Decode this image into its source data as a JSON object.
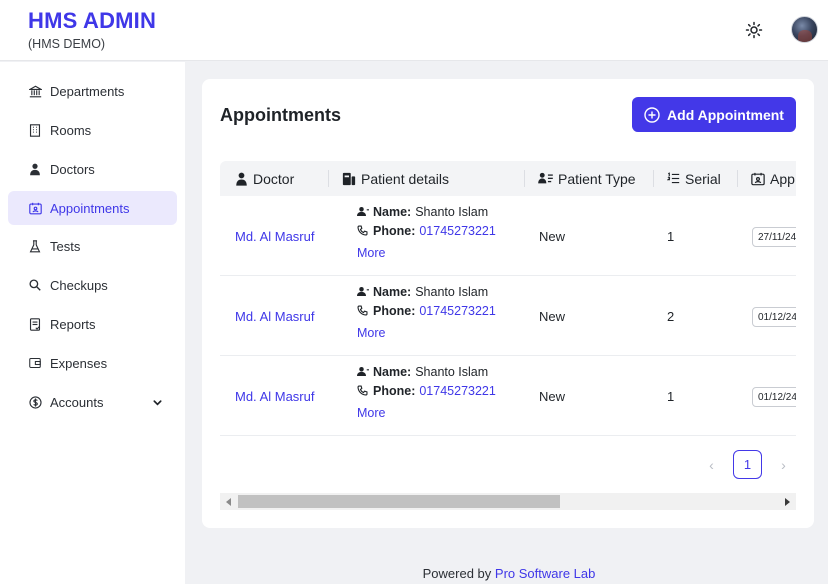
{
  "header": {
    "title": "HMS ADMIN",
    "subtitle": "(HMS DEMO)",
    "theme_icon": "sun-icon",
    "avatar_icon": "user-avatar"
  },
  "sidebar": {
    "items": [
      {
        "label": "Departments",
        "icon": "bank-icon"
      },
      {
        "label": "Rooms",
        "icon": "building-icon"
      },
      {
        "label": "Doctors",
        "icon": "doctor-icon"
      },
      {
        "label": "Appointments",
        "icon": "calendar-person-icon",
        "active": true
      },
      {
        "label": "Tests",
        "icon": "flask-icon"
      },
      {
        "label": "Checkups",
        "icon": "search-icon"
      },
      {
        "label": "Reports",
        "icon": "report-icon"
      },
      {
        "label": "Expenses",
        "icon": "wallet-icon"
      },
      {
        "label": "Accounts",
        "icon": "dollar-circle-icon",
        "expandable": true
      }
    ]
  },
  "main": {
    "title": "Appointments",
    "add_button_label": "Add Appointment",
    "columns": [
      "Doctor",
      "Patient details",
      "Patient Type",
      "Serial",
      "App"
    ],
    "labels": {
      "name": "Name:",
      "phone": "Phone:",
      "more": "More"
    },
    "rows": [
      {
        "doctor": "Md. Al Masruf",
        "patient_name": "Shanto Islam",
        "phone": "01745273221",
        "type": "New",
        "serial": "1",
        "date": "27/11/24"
      },
      {
        "doctor": "Md. Al Masruf",
        "patient_name": "Shanto Islam",
        "phone": "01745273221",
        "type": "New",
        "serial": "2",
        "date": "01/12/24"
      },
      {
        "doctor": "Md. Al Masruf",
        "patient_name": "Shanto Islam",
        "phone": "01745273221",
        "type": "New",
        "serial": "1",
        "date": "01/12/24"
      }
    ],
    "pagination": {
      "current": "1",
      "prev": "‹",
      "next": "›"
    }
  },
  "footer": {
    "prefix": "Powered by",
    "link": "Pro Software Lab"
  },
  "colors": {
    "accent": "#4338e8",
    "link": "#3f37e8",
    "active_bg": "#ebe9fd"
  }
}
